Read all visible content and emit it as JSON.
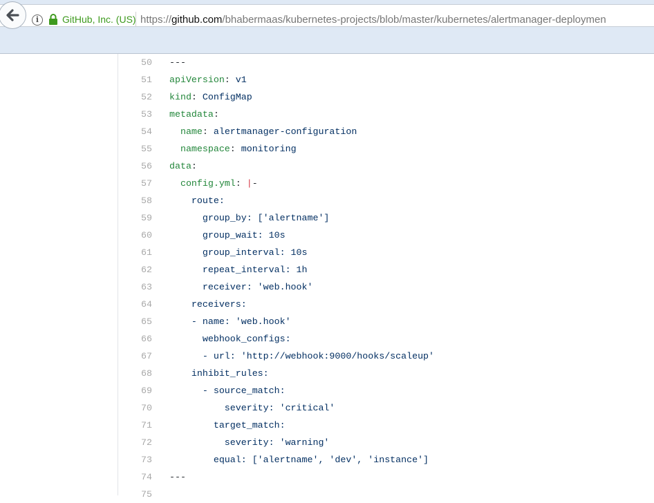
{
  "browser": {
    "org_label": "GitHub, Inc. (US)",
    "url_prefix": "https://",
    "url_host": "github.com",
    "url_path": "/bhabermaas/kubernetes-projects/blob/master/kubernetes/alertmanager-deploymen"
  },
  "colors": {
    "key": "#22863a",
    "value": "#032f62",
    "operator": "#d73a49",
    "line_number": "#a8a8a8"
  },
  "lines": [
    {
      "num": "50",
      "parts": [
        [
          "p",
          "---"
        ]
      ]
    },
    {
      "num": "51",
      "parts": [
        [
          "k",
          "apiVersion"
        ],
        [
          "p",
          ": "
        ],
        [
          "v",
          "v1"
        ]
      ]
    },
    {
      "num": "52",
      "parts": [
        [
          "k",
          "kind"
        ],
        [
          "p",
          ": "
        ],
        [
          "v",
          "ConfigMap"
        ]
      ]
    },
    {
      "num": "53",
      "parts": [
        [
          "k",
          "metadata"
        ],
        [
          "p",
          ":"
        ]
      ]
    },
    {
      "num": "54",
      "parts": [
        [
          "p",
          "  "
        ],
        [
          "k",
          "name"
        ],
        [
          "p",
          ": "
        ],
        [
          "v",
          "alertmanager-configuration"
        ]
      ]
    },
    {
      "num": "55",
      "parts": [
        [
          "p",
          "  "
        ],
        [
          "k",
          "namespace"
        ],
        [
          "p",
          ": "
        ],
        [
          "v",
          "monitoring"
        ]
      ]
    },
    {
      "num": "56",
      "parts": [
        [
          "k",
          "data"
        ],
        [
          "p",
          ":"
        ]
      ]
    },
    {
      "num": "57",
      "parts": [
        [
          "p",
          "  "
        ],
        [
          "k",
          "config.yml"
        ],
        [
          "p",
          ": "
        ],
        [
          "o",
          "|"
        ],
        [
          "p",
          "-"
        ]
      ]
    },
    {
      "num": "58",
      "parts": [
        [
          "v",
          "    route:"
        ]
      ]
    },
    {
      "num": "59",
      "parts": [
        [
          "v",
          "      group_by: ['alertname']"
        ]
      ]
    },
    {
      "num": "60",
      "parts": [
        [
          "v",
          "      group_wait: 10s"
        ]
      ]
    },
    {
      "num": "61",
      "parts": [
        [
          "v",
          "      group_interval: 10s"
        ]
      ]
    },
    {
      "num": "62",
      "parts": [
        [
          "v",
          "      repeat_interval: 1h"
        ]
      ]
    },
    {
      "num": "63",
      "parts": [
        [
          "v",
          "      receiver: 'web.hook'"
        ]
      ]
    },
    {
      "num": "64",
      "parts": [
        [
          "v",
          "    receivers:"
        ]
      ]
    },
    {
      "num": "65",
      "parts": [
        [
          "v",
          "    - name: 'web.hook'"
        ]
      ]
    },
    {
      "num": "66",
      "parts": [
        [
          "v",
          "      webhook_configs:"
        ]
      ]
    },
    {
      "num": "67",
      "parts": [
        [
          "v",
          "      - url: 'http://webhook:9000/hooks/scaleup'"
        ]
      ]
    },
    {
      "num": "68",
      "parts": [
        [
          "v",
          "    inhibit_rules:"
        ]
      ]
    },
    {
      "num": "69",
      "parts": [
        [
          "v",
          "      - source_match:"
        ]
      ]
    },
    {
      "num": "70",
      "parts": [
        [
          "v",
          "          severity: 'critical'"
        ]
      ]
    },
    {
      "num": "71",
      "parts": [
        [
          "v",
          "        target_match:"
        ]
      ]
    },
    {
      "num": "72",
      "parts": [
        [
          "v",
          "          severity: 'warning'"
        ]
      ]
    },
    {
      "num": "73",
      "parts": [
        [
          "v",
          "        equal: ['alertname', 'dev', 'instance']"
        ]
      ]
    },
    {
      "num": "74",
      "parts": [
        [
          "p",
          "---"
        ]
      ]
    },
    {
      "num": "75",
      "parts": []
    }
  ]
}
